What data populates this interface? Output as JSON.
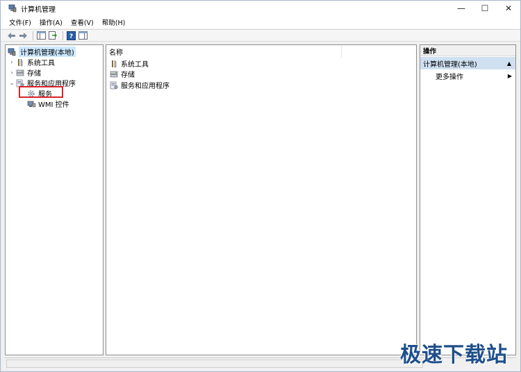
{
  "window": {
    "title": "计算机管理"
  },
  "title_controls": {
    "minimize": "—",
    "maximize": "☐",
    "close": "✕"
  },
  "menu": [
    {
      "label": "文件(F)"
    },
    {
      "label": "操作(A)"
    },
    {
      "label": "查看(V)"
    },
    {
      "label": "帮助(H)"
    }
  ],
  "tree": {
    "root": "计算机管理(本地)",
    "items": [
      {
        "label": "系统工具",
        "caret": "›"
      },
      {
        "label": "存储",
        "caret": "›"
      },
      {
        "label": "服务和应用程序",
        "caret": "⌄"
      },
      {
        "label": "服务"
      },
      {
        "label": "WMI 控件"
      }
    ]
  },
  "list": {
    "column_name": "名称",
    "rows": [
      {
        "label": "系统工具"
      },
      {
        "label": "存储"
      },
      {
        "label": "服务和应用程序"
      }
    ]
  },
  "actions": {
    "header": "操作",
    "section": "计算机管理(本地)",
    "up_arrow": "▲",
    "more": "更多操作",
    "more_arrow": "▶"
  },
  "watermark": "极速下载站",
  "colors": {
    "selection": "#cce8ff",
    "highlight_border": "#d9232d",
    "action_section": "#cfe0f1"
  }
}
